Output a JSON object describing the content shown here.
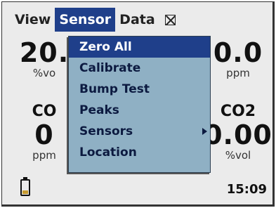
{
  "menubar": {
    "items": [
      "View",
      "Sensor",
      "Data"
    ],
    "active_index": 1
  },
  "tiles": {
    "top_left": {
      "reading": "20.",
      "unit": "%vo"
    },
    "top_right": {
      "reading": "0.0",
      "unit": "ppm"
    },
    "bottom_left": {
      "gas": "CO",
      "reading": "0",
      "unit": "ppm"
    },
    "bottom_right": {
      "gas": "CO2",
      "reading": "0.00",
      "unit": "%vol"
    }
  },
  "dropdown": {
    "items": [
      {
        "label": "Zero All",
        "selected": true,
        "submenu": false
      },
      {
        "label": "Calibrate",
        "selected": false,
        "submenu": false
      },
      {
        "label": "Bump Test",
        "selected": false,
        "submenu": false
      },
      {
        "label": "Peaks",
        "selected": false,
        "submenu": false
      },
      {
        "label": "Sensors",
        "selected": false,
        "submenu": true
      },
      {
        "label": "Location",
        "selected": false,
        "submenu": false
      }
    ]
  },
  "status": {
    "time": "15:09",
    "battery_icon": "battery-icon",
    "battery_level": 0.25,
    "battery_color": "#c69a2e"
  },
  "colors": {
    "highlight": "#1f3f8a",
    "menu_bg": "#8fb0c4",
    "screen_bg": "#ebebeb"
  }
}
